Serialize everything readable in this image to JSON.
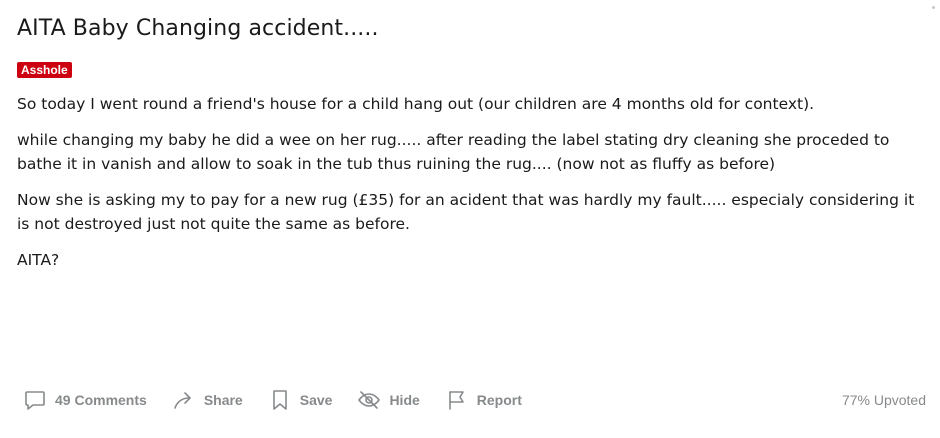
{
  "post": {
    "title": "AITA Baby Changing accident.....",
    "flair": "Asshole",
    "paragraphs": [
      "So today I went round a friend's house for a child hang out (our children are 4 months old for context).",
      "while changing my baby he did a wee on her rug..... after reading the label stating dry cleaning she proceded to bathe it in vanish and allow to soak in the tub thus ruining the rug.... (now not as fluffy as before)",
      "Now she is asking my to pay for a new rug (£35) for an acident that was hardly my fault..... especialy considering it is not destroyed just not quite the same as before.",
      "AITA?"
    ]
  },
  "footer": {
    "comments_label": "49 Comments",
    "share_label": "Share",
    "save_label": "Save",
    "hide_label": "Hide",
    "report_label": "Report",
    "upvoted_label": "77% Upvoted"
  },
  "colors": {
    "flair_bg": "#cc0010",
    "text": "#1a1a1b",
    "muted": "#878a8c"
  },
  "icons": {
    "comments": "comment-bubble-icon",
    "share": "share-arrow-icon",
    "save": "bookmark-icon",
    "hide": "eye-slash-icon",
    "report": "flag-icon"
  }
}
